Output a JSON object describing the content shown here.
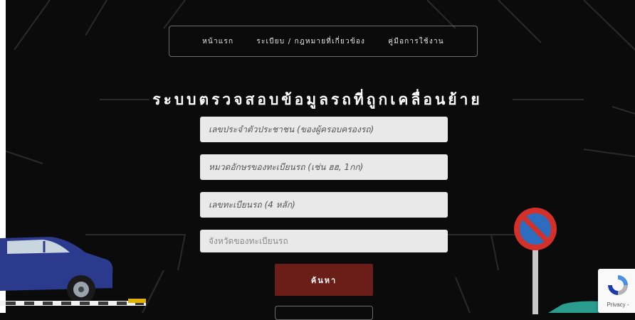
{
  "nav": {
    "items": [
      {
        "label": "หน้าแรก"
      },
      {
        "label": "ระเบียบ / กฎหมายที่เกี่ยวข้อง"
      },
      {
        "label": "คู่มือการใช้งาน"
      }
    ]
  },
  "page": {
    "title": "ระบบตรวจสอบข้อมูลรถที่ถูกเคลื่อนย้าย"
  },
  "form": {
    "id_card_placeholder": "เลขประจำตัวประชาชน (ของผู้ครอบครองรถ)",
    "plate_letters_placeholder": "หมวดอักษรของทะเบียนรถ (เช่น ฮฮ, 1กก)",
    "plate_number_placeholder": "เลขทะเบียนรถ (4 หลัก)",
    "province_placeholder": "จังหวัดของทะเบียนรถ",
    "search_label": "ค้นหา"
  },
  "recaptcha": {
    "links_label": "Privacy -"
  },
  "colors": {
    "background": "#0b0b0b",
    "button": "#6b1d17",
    "field": "#e9e9e9",
    "car": "#2b3a8c"
  }
}
